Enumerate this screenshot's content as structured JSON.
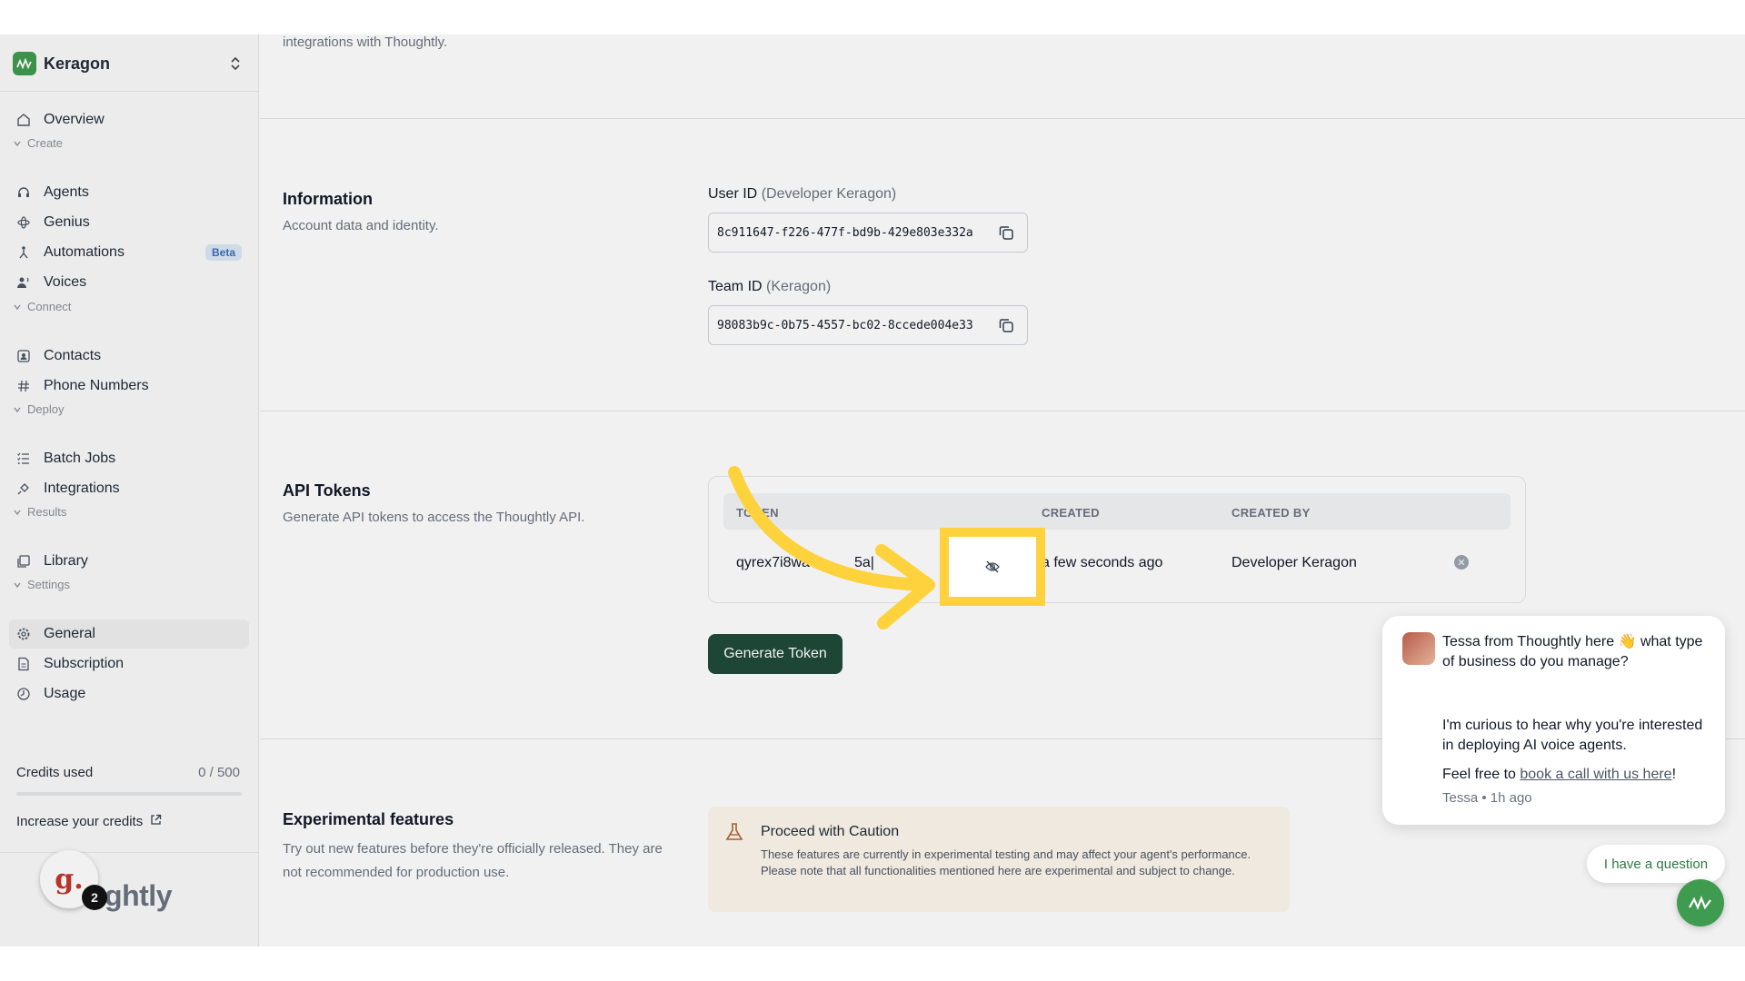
{
  "sidebar": {
    "team_name": "Keragon",
    "items": [
      {
        "label": "Overview",
        "icon": "home-icon"
      },
      {
        "label": "Agents",
        "icon": "headset-icon"
      },
      {
        "label": "Genius",
        "icon": "atom-icon"
      },
      {
        "label": "Automations",
        "icon": "workflow-icon",
        "badge": "Beta"
      },
      {
        "label": "Voices",
        "icon": "voices-icon"
      },
      {
        "label": "Contacts",
        "icon": "contacts-icon"
      },
      {
        "label": "Phone Numbers",
        "icon": "hash-icon"
      },
      {
        "label": "Batch Jobs",
        "icon": "list-icon"
      },
      {
        "label": "Integrations",
        "icon": "plug-icon"
      },
      {
        "label": "Library",
        "icon": "library-icon"
      },
      {
        "label": "General",
        "icon": "gear-icon",
        "active": true
      },
      {
        "label": "Subscription",
        "icon": "file-icon"
      },
      {
        "label": "Usage",
        "icon": "clock-icon"
      }
    ],
    "sections": {
      "create": "Create",
      "connect": "Connect",
      "deploy": "Deploy",
      "results": "Results",
      "settings": "Settings"
    },
    "credits": {
      "label": "Credits used",
      "value": "0 / 500",
      "fraction": 0.0
    },
    "increase_label": "Increase your credits",
    "brand_word": "ughtly",
    "notification_avatar_letter": "g.",
    "notification_count": "2"
  },
  "main": {
    "top_desc": "integrations with Thoughtly.",
    "information": {
      "title": "Information",
      "desc": "Account data and identity.",
      "user_id_label": "User ID",
      "user_id_hint": "(Developer Keragon)",
      "user_id_value": "8c911647-f226-477f-bd9b-429e803e332a",
      "team_id_label": "Team ID",
      "team_id_hint": "(Keragon)",
      "team_id_value": "98083b9c-0b75-4557-bc02-8ccede004e33"
    },
    "api_tokens": {
      "title": "API Tokens",
      "desc": "Generate API tokens to access the Thoughtly API.",
      "columns": {
        "token": "TOKEN",
        "token_visible": "T",
        "token_tail": "EN",
        "created": "CREATED",
        "created_by": "CREATED BY"
      },
      "row": {
        "token_start": "qyrex7i8wa",
        "token_mid": "5a|",
        "created": "a few seconds ago",
        "created_by": "Developer Keragon"
      },
      "generate_button": "Generate Token"
    },
    "experimental": {
      "title": "Experimental features",
      "desc": "Try out new features before they're officially released. They are not recommended for production use.",
      "caution_title": "Proceed with Caution",
      "caution_text": "These features are currently in experimental testing and may affect your agent's performance. Please note that all functionalities mentioned here are experimental and subject to change."
    }
  },
  "chat": {
    "line1": "Tessa from Thoughtly here 👋 what type of business do you manage?",
    "line2": "I'm curious to hear why you're interested in deploying AI voice agents.",
    "line3_prefix": "Feel free to ",
    "line3_link": "book a call with us here",
    "line3_suffix": "!",
    "meta": "Tessa • 1h ago",
    "question_button": "I have a question"
  },
  "colors": {
    "accent_green": "#3f9b4f",
    "button_dark_green": "#1e4a3a",
    "highlight_yellow": "#fdd23c"
  }
}
